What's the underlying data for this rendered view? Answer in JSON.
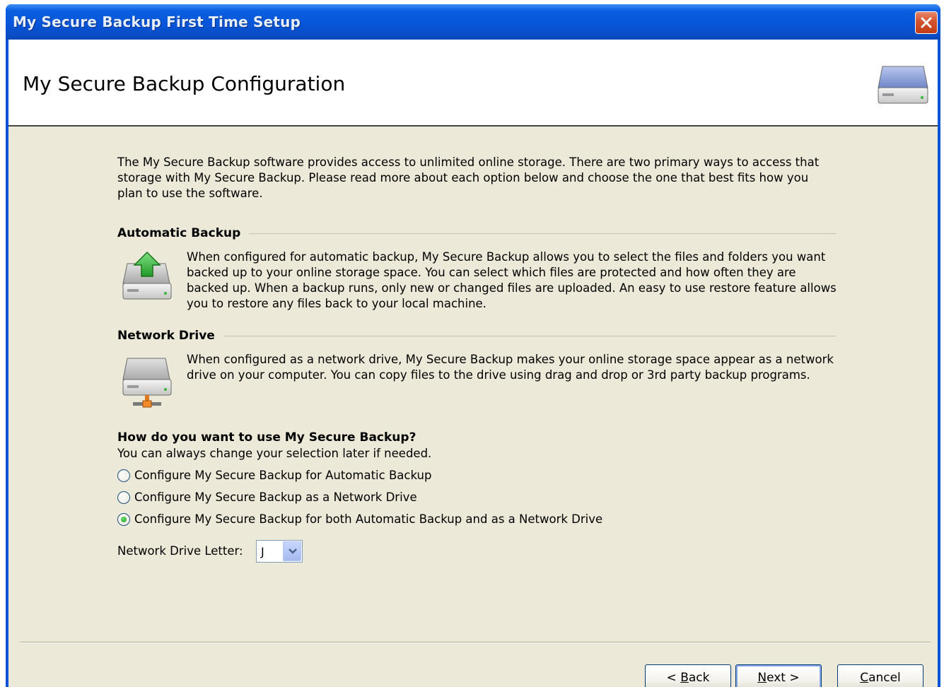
{
  "window": {
    "title": "My Secure Backup First Time Setup",
    "close_icon": "close-icon"
  },
  "header": {
    "title": "My Secure Backup Configuration",
    "icon": "hard-drive-icon"
  },
  "intro": "The My Secure Backup software provides access to unlimited online storage. There are two primary ways to access that storage with My Secure Backup. Please read more about each option below and choose the one that best fits how you plan to use the software.",
  "sections": {
    "automatic": {
      "title": "Automatic Backup",
      "icon": "upload-drive-icon",
      "text": "When configured for automatic backup, My Secure Backup allows you to select the files and folders you want backed up to your online storage space. You can select which files are protected and how often they are backed up. When a backup runs, only new or changed files are uploaded. An easy to use restore feature allows you to restore any files back to your local machine."
    },
    "network": {
      "title": "Network Drive",
      "icon": "network-drive-icon",
      "text": "When configured as a network drive, My Secure Backup makes your online storage space appear as a network drive on your computer. You can copy files to the drive using drag and drop or 3rd party backup programs."
    }
  },
  "question": {
    "title": "How do you want to use My Secure Backup?",
    "hint": "You can always change your selection later if needed.",
    "options": [
      {
        "label": "Configure My Secure Backup for Automatic Backup",
        "checked": false
      },
      {
        "label": "Configure My Secure Backup as a Network Drive",
        "checked": false
      },
      {
        "label": "Configure My Secure Backup for both Automatic Backup and as a Network Drive",
        "checked": true
      }
    ]
  },
  "drive_letter": {
    "label": "Network Drive Letter:",
    "value": "J"
  },
  "buttons": {
    "back_pre": "< ",
    "back_key": "B",
    "back_post": "ack",
    "next_key": "N",
    "next_post": "ext >",
    "cancel_key": "C",
    "cancel_post": "ancel"
  }
}
